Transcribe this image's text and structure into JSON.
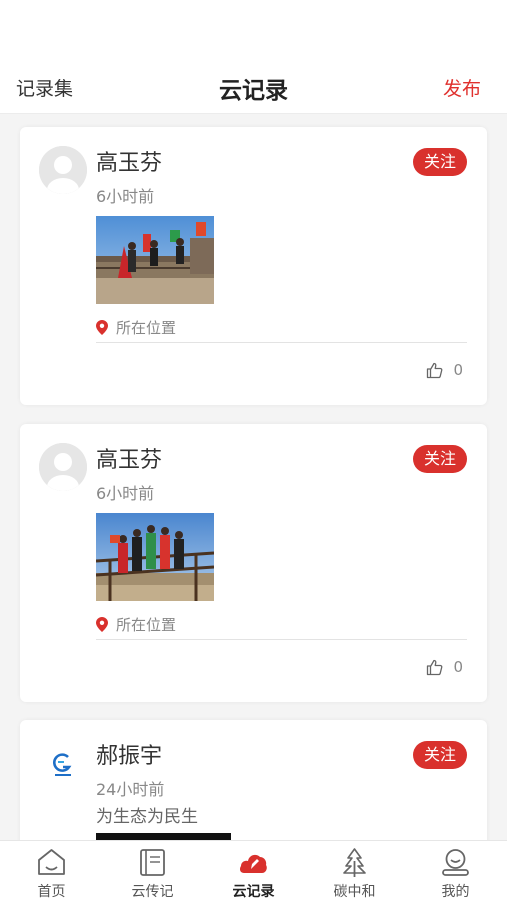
{
  "header": {
    "left_label": "记录集",
    "title": "云记录",
    "right_label": "发布"
  },
  "posts": [
    {
      "name": "高玉芬",
      "time": "6小时前",
      "follow_label": "关注",
      "location": "所在位置",
      "likes": "0"
    },
    {
      "name": "高玉芬",
      "time": "6小时前",
      "follow_label": "关注",
      "location": "所在位置",
      "likes": "0"
    },
    {
      "name": "郝振宇",
      "time": "24小时前",
      "description": "为生态为民生",
      "follow_label": "关注"
    }
  ],
  "tabs": [
    {
      "label": "首页",
      "icon": "home-icon"
    },
    {
      "label": "云传记",
      "icon": "book-icon"
    },
    {
      "label": "云记录",
      "icon": "cloud-record-icon",
      "active": true
    },
    {
      "label": "碳中和",
      "icon": "tree-icon"
    },
    {
      "label": "我的",
      "icon": "profile-icon"
    }
  ],
  "colors": {
    "accent": "#d9312d",
    "link_red": "#e0312e",
    "background": "#f4f4f4"
  }
}
